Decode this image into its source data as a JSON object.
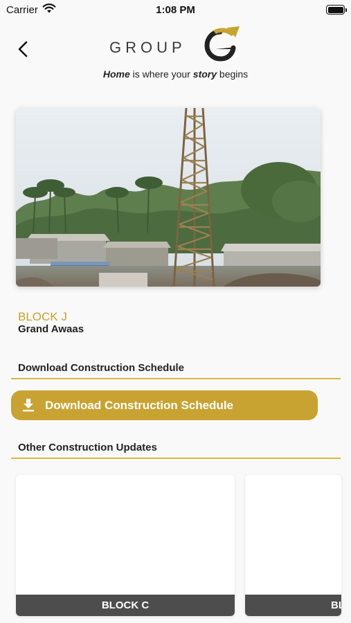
{
  "status_bar": {
    "carrier": "Carrier",
    "time": "1:08 PM"
  },
  "header": {
    "logo_text": "GROUP",
    "tagline": {
      "part1": "Home",
      "part2": " is where your ",
      "part3": "story",
      "part4": " begins"
    }
  },
  "project": {
    "block": "BLOCK J",
    "name": "Grand Awaas"
  },
  "schedule_section": {
    "heading": "Download Construction Schedule",
    "button_label": "Download Construction Schedule"
  },
  "updates_section": {
    "heading": "Other Construction Updates",
    "cards": [
      {
        "label": "BLOCK C"
      },
      {
        "label": "BLOCK"
      }
    ]
  },
  "colors": {
    "gold": "#c9a332",
    "gold_text": "#c9a227",
    "card_label_bg": "#4d4d4d"
  },
  "icons": [
    "wifi-icon",
    "battery-icon",
    "back-arrow-icon",
    "download-icon"
  ]
}
